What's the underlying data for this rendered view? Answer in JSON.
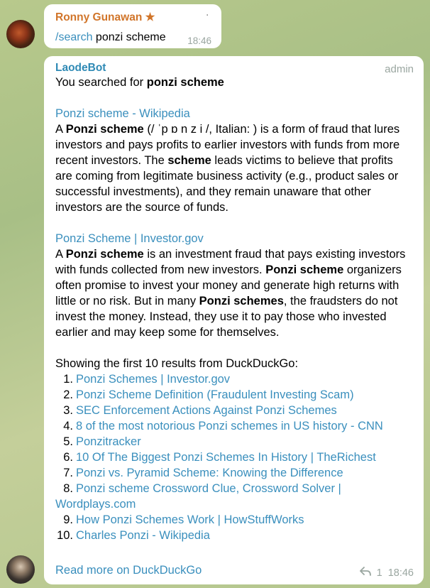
{
  "msg1": {
    "sender": "Ronny Gunawan ★",
    "command": "/search",
    "query": "ponzi scheme",
    "time": "18:46",
    "dot": "·"
  },
  "msg2": {
    "sender": "LaodeBot",
    "role": "admin",
    "intro_prefix": "You searched for ",
    "intro_query": "ponzi scheme",
    "results": [
      {
        "title": "Ponzi scheme - Wikipedia",
        "body": [
          {
            "t": "A ",
            "b": false
          },
          {
            "t": "Ponzi scheme",
            "b": true
          },
          {
            "t": " (/ ˈp ɒ n z i /, Italian: ) is a form of fraud that lures investors and pays profits to earlier investors with funds from more recent investors. The ",
            "b": false
          },
          {
            "t": "scheme",
            "b": true
          },
          {
            "t": " leads victims to believe that profits are coming from legitimate business activity (e.g., product sales or successful investments), and they remain unaware that other investors are the source of funds.",
            "b": false
          }
        ]
      },
      {
        "title": "Ponzi Scheme | Investor.gov",
        "body": [
          {
            "t": "A ",
            "b": false
          },
          {
            "t": "Ponzi scheme",
            "b": true
          },
          {
            "t": " is an investment fraud that pays existing investors with funds collected from new investors. ",
            "b": false
          },
          {
            "t": "Ponzi scheme",
            "b": true
          },
          {
            "t": " organizers often promise to invest your money and generate high returns with little or no risk. But in many ",
            "b": false
          },
          {
            "t": "Ponzi schemes",
            "b": true
          },
          {
            "t": ", the fraudsters do not invest the money. Instead, they use it to pay those who invested earlier and may keep some for themselves.",
            "b": false
          }
        ]
      }
    ],
    "list_intro": "Showing the first 10 results from DuckDuckGo:",
    "list": [
      {
        "n": "1.",
        "label": "Ponzi Schemes | Investor.gov"
      },
      {
        "n": "2.",
        "label": "Ponzi Scheme Definition (Fraudulent Investing Scam)"
      },
      {
        "n": "3.",
        "label": "SEC Enforcement Actions Against Ponzi Schemes"
      },
      {
        "n": "4.",
        "label": "8 of the most notorious Ponzi schemes in US history - CNN"
      },
      {
        "n": "5.",
        "label": "Ponzitracker"
      },
      {
        "n": "6.",
        "label": "10 Of The Biggest Ponzi Schemes In History | TheRichest"
      },
      {
        "n": "7.",
        "label": "Ponzi vs. Pyramid Scheme: Knowing the Difference"
      },
      {
        "n": "8.",
        "label": "Ponzi scheme Crossword Clue, Crossword Solver | Wordplays.com"
      },
      {
        "n": "9.",
        "label": "How Ponzi Schemes Work | HowStuffWorks"
      },
      {
        "n": "10.",
        "label": "Charles Ponzi - Wikipedia"
      }
    ],
    "read_more": "Read more on DuckDuckGo",
    "replies": "1",
    "time": "18:46"
  },
  "colors": {
    "link": "#3a8fbd",
    "sender1": "#d1752a",
    "sender2": "#2f8ab5",
    "meta": "#9aa6a0"
  }
}
